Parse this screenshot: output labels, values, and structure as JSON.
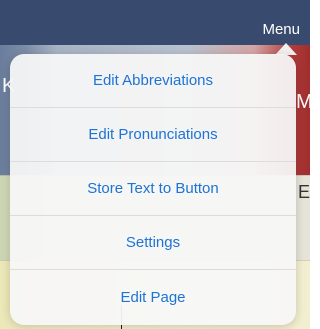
{
  "topbar": {
    "menu_label": "Menu"
  },
  "menu": {
    "items": [
      {
        "label": "Edit Abbreviations"
      },
      {
        "label": "Edit Pronunciations"
      },
      {
        "label": "Store Text to Button"
      },
      {
        "label": "Settings"
      },
      {
        "label": "Edit Page"
      }
    ]
  },
  "background": {
    "glyph_left": "K",
    "glyph_right": "M",
    "glyph_right_row2": "E"
  },
  "colors": {
    "topbar": "#384b6e",
    "menu_text": "#1d73d6",
    "popover": "#f7f7f7"
  }
}
